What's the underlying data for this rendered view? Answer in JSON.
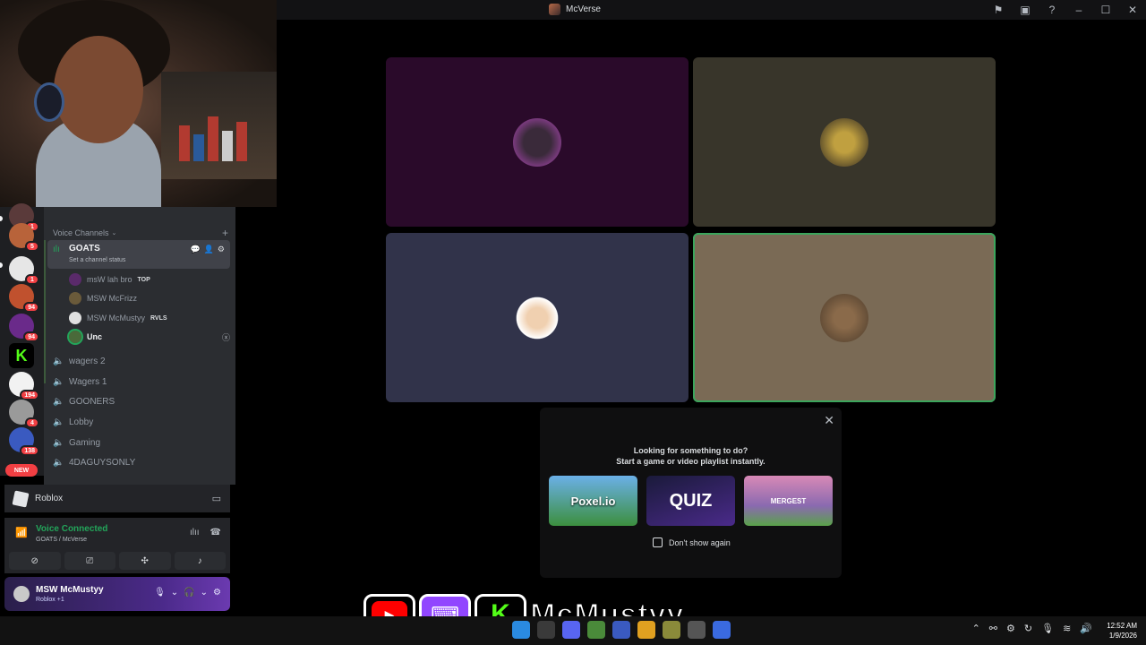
{
  "window": {
    "title": "McVerse"
  },
  "titlebar_icons": [
    "inbox-flag-icon",
    "inbox-icon",
    "help-icon",
    "minimize-icon",
    "maximize-icon",
    "close-icon"
  ],
  "servers": [
    {
      "badge": "1"
    },
    {
      "badge": "5"
    },
    {
      "badge": "1"
    },
    {
      "badge": "94"
    },
    {
      "badge": "94"
    },
    {
      "badge": ""
    },
    {
      "badge": "194"
    },
    {
      "badge": "4"
    },
    {
      "badge": "138"
    }
  ],
  "new_badge": "NEW",
  "channels": {
    "category_label": "Voice Channels",
    "active_channel": {
      "name": "GOATS",
      "status_placeholder": "Set a channel status"
    },
    "members": [
      {
        "name": "msW lah bro",
        "tag": "TOP"
      },
      {
        "name": "MSW McFrizz",
        "tag": ""
      },
      {
        "name": "MSW McMustyy",
        "tag": "RVLS"
      },
      {
        "name": "Unc",
        "tag": ""
      }
    ],
    "voice_channels": [
      "wagers 2",
      "Wagers 1",
      "GOONERS",
      "Lobby",
      "Gaming",
      "4DAGUYSONLY"
    ]
  },
  "activity": {
    "game": "Roblox"
  },
  "voice": {
    "status": "Voice Connected",
    "location": "GOATS / McVerse"
  },
  "user": {
    "name": "MSW McMustyy",
    "status": "Roblox +1"
  },
  "popup": {
    "line1": "Looking for something to do?",
    "line2": "Start a game or video playlist instantly.",
    "games": [
      "Poxel.io",
      "QUIZ",
      "MERGEST"
    ],
    "checkbox_label": "Don't show again"
  },
  "overlay": {
    "streamer_name": "McMustyy"
  },
  "clock": {
    "time": "12:52 AM",
    "date": "1/9/2026"
  },
  "colors": {
    "tile_1": "#2a0a2a",
    "tile_2": "#38352a",
    "tile_3": "#31334a",
    "tile_4": "#7a6a55",
    "speaking": "#3ba55c",
    "voice_green": "#23a55a"
  }
}
